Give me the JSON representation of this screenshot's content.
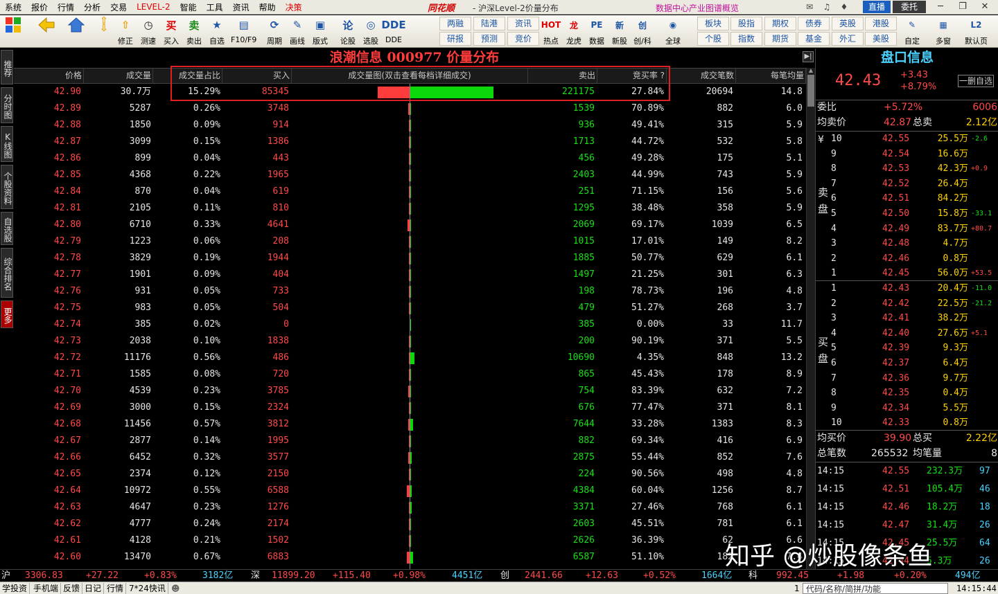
{
  "menubar": {
    "items": [
      "系统",
      "报价",
      "行情",
      "分析",
      "交易",
      "LEVEL-2",
      "智能",
      "工具",
      "资讯",
      "帮助",
      "决策"
    ],
    "brand": "同花顺",
    "window_title": "- 沪深Level-2价量分布",
    "ad_text": "数据中心产业图谱概览",
    "zhibo": "直播",
    "weituo": "委托"
  },
  "toolbar": {
    "big": [
      {
        "name": "修正",
        "icon": "⇧"
      },
      {
        "name": "测速",
        "icon": "◷"
      },
      {
        "name": "买入",
        "icon": "买"
      },
      {
        "name": "卖出",
        "icon": "卖"
      },
      {
        "name": "自选",
        "icon": "★"
      },
      {
        "name": "F10/F9",
        "icon": "▤"
      },
      {
        "name": "周期",
        "icon": "⟳"
      },
      {
        "name": "画线",
        "icon": "✎"
      },
      {
        "name": "版式",
        "icon": "▣"
      },
      {
        "name": "论股",
        "icon": "论"
      },
      {
        "name": "选股",
        "icon": "◎"
      },
      {
        "name": "DDE",
        "icon": "DDE"
      }
    ],
    "small_top": [
      "两融",
      "陆港",
      "资讯"
    ],
    "small_bottom": [
      "研报",
      "预测",
      "竞价"
    ],
    "big2": [
      {
        "name": "热点",
        "icon": "HOT"
      },
      {
        "name": "龙虎",
        "icon": "龙"
      },
      {
        "name": "数据",
        "icon": "PE"
      },
      {
        "name": "新股",
        "icon": "新"
      },
      {
        "name": "创/科",
        "icon": "创"
      },
      {
        "name": "全球",
        "icon": "◉"
      }
    ],
    "small2_top": [
      "板块",
      "股指",
      "期权",
      "债券",
      "英股",
      "港股"
    ],
    "small2_bottom": [
      "个股",
      "指数",
      "期货",
      "基金",
      "外汇",
      "美股"
    ],
    "big3": [
      {
        "name": "自定",
        "icon": "✎"
      },
      {
        "name": "多窗",
        "icon": "▦"
      },
      {
        "name": "默认页",
        "icon": "L2"
      }
    ]
  },
  "sidetabs": [
    "推荐",
    "分时图",
    "K线图",
    "个股资料",
    "自选股",
    "综合排名",
    "更多"
  ],
  "page_title": "浪潮信息 000977 价量分布",
  "columns": {
    "price": "价格",
    "volume": "成交量",
    "ratio": "成交量占比",
    "buy": "买入",
    "chart": "成交量图(双击查看每档详细成交)",
    "sell": "卖出",
    "buy_rate": "竞买率 ?",
    "trades": "成交笔数",
    "avg": "每笔均量"
  },
  "rows": [
    {
      "price": "42.90",
      "volume": "30.7万",
      "ratio": "15.29%",
      "buy": "85345",
      "sell": "221175",
      "buy_rate": "27.84%",
      "trades": "20694",
      "avg": "14.8",
      "buy_n": 85345,
      "sell_n": 221175
    },
    {
      "price": "42.89",
      "volume": "5287",
      "ratio": "0.26%",
      "buy": "3748",
      "sell": "1539",
      "buy_rate": "70.89%",
      "trades": "882",
      "avg": "6.0",
      "buy_n": 3748,
      "sell_n": 1539
    },
    {
      "price": "42.88",
      "volume": "1850",
      "ratio": "0.09%",
      "buy": "914",
      "sell": "936",
      "buy_rate": "49.41%",
      "trades": "315",
      "avg": "5.9",
      "buy_n": 914,
      "sell_n": 936
    },
    {
      "price": "42.87",
      "volume": "3099",
      "ratio": "0.15%",
      "buy": "1386",
      "sell": "1713",
      "buy_rate": "44.72%",
      "trades": "532",
      "avg": "5.8",
      "buy_n": 1386,
      "sell_n": 1713
    },
    {
      "price": "42.86",
      "volume": "899",
      "ratio": "0.04%",
      "buy": "443",
      "sell": "456",
      "buy_rate": "49.28%",
      "trades": "175",
      "avg": "5.1",
      "buy_n": 443,
      "sell_n": 456
    },
    {
      "price": "42.85",
      "volume": "4368",
      "ratio": "0.22%",
      "buy": "1965",
      "sell": "2403",
      "buy_rate": "44.99%",
      "trades": "743",
      "avg": "5.9",
      "buy_n": 1965,
      "sell_n": 2403
    },
    {
      "price": "42.84",
      "volume": "870",
      "ratio": "0.04%",
      "buy": "619",
      "sell": "251",
      "buy_rate": "71.15%",
      "trades": "156",
      "avg": "5.6",
      "buy_n": 619,
      "sell_n": 251
    },
    {
      "price": "42.81",
      "volume": "2105",
      "ratio": "0.11%",
      "buy": "810",
      "sell": "1295",
      "buy_rate": "38.48%",
      "trades": "358",
      "avg": "5.9",
      "buy_n": 810,
      "sell_n": 1295
    },
    {
      "price": "42.80",
      "volume": "6710",
      "ratio": "0.33%",
      "buy": "4641",
      "sell": "2069",
      "buy_rate": "69.17%",
      "trades": "1039",
      "avg": "6.5",
      "buy_n": 4641,
      "sell_n": 2069
    },
    {
      "price": "42.79",
      "volume": "1223",
      "ratio": "0.06%",
      "buy": "208",
      "sell": "1015",
      "buy_rate": "17.01%",
      "trades": "149",
      "avg": "8.2",
      "buy_n": 208,
      "sell_n": 1015
    },
    {
      "price": "42.78",
      "volume": "3829",
      "ratio": "0.19%",
      "buy": "1944",
      "sell": "1885",
      "buy_rate": "50.77%",
      "trades": "629",
      "avg": "6.1",
      "buy_n": 1944,
      "sell_n": 1885
    },
    {
      "price": "42.77",
      "volume": "1901",
      "ratio": "0.09%",
      "buy": "404",
      "sell": "1497",
      "buy_rate": "21.25%",
      "trades": "301",
      "avg": "6.3",
      "buy_n": 404,
      "sell_n": 1497
    },
    {
      "price": "42.76",
      "volume": "931",
      "ratio": "0.05%",
      "buy": "733",
      "sell": "198",
      "buy_rate": "78.73%",
      "trades": "196",
      "avg": "4.8",
      "buy_n": 733,
      "sell_n": 198
    },
    {
      "price": "42.75",
      "volume": "983",
      "ratio": "0.05%",
      "buy": "504",
      "sell": "479",
      "buy_rate": "51.27%",
      "trades": "268",
      "avg": "3.7",
      "buy_n": 504,
      "sell_n": 479
    },
    {
      "price": "42.74",
      "volume": "385",
      "ratio": "0.02%",
      "buy": "0",
      "sell": "385",
      "buy_rate": "0.00%",
      "trades": "33",
      "avg": "11.7",
      "buy_n": 0,
      "sell_n": 385
    },
    {
      "price": "42.73",
      "volume": "2038",
      "ratio": "0.10%",
      "buy": "1838",
      "sell": "200",
      "buy_rate": "90.19%",
      "trades": "371",
      "avg": "5.5",
      "buy_n": 1838,
      "sell_n": 200
    },
    {
      "price": "42.72",
      "volume": "11176",
      "ratio": "0.56%",
      "buy": "486",
      "sell": "10690",
      "buy_rate": "4.35%",
      "trades": "848",
      "avg": "13.2",
      "buy_n": 486,
      "sell_n": 10690
    },
    {
      "price": "42.71",
      "volume": "1585",
      "ratio": "0.08%",
      "buy": "720",
      "sell": "865",
      "buy_rate": "45.43%",
      "trades": "178",
      "avg": "8.9",
      "buy_n": 720,
      "sell_n": 865
    },
    {
      "price": "42.70",
      "volume": "4539",
      "ratio": "0.23%",
      "buy": "3785",
      "sell": "754",
      "buy_rate": "83.39%",
      "trades": "632",
      "avg": "7.2",
      "buy_n": 3785,
      "sell_n": 754
    },
    {
      "price": "42.69",
      "volume": "3000",
      "ratio": "0.15%",
      "buy": "2324",
      "sell": "676",
      "buy_rate": "77.47%",
      "trades": "371",
      "avg": "8.1",
      "buy_n": 2324,
      "sell_n": 676
    },
    {
      "price": "42.68",
      "volume": "11456",
      "ratio": "0.57%",
      "buy": "3812",
      "sell": "7644",
      "buy_rate": "33.28%",
      "trades": "1383",
      "avg": "8.3",
      "buy_n": 3812,
      "sell_n": 7644
    },
    {
      "price": "42.67",
      "volume": "2877",
      "ratio": "0.14%",
      "buy": "1995",
      "sell": "882",
      "buy_rate": "69.34%",
      "trades": "416",
      "avg": "6.9",
      "buy_n": 1995,
      "sell_n": 882
    },
    {
      "price": "42.66",
      "volume": "6452",
      "ratio": "0.32%",
      "buy": "3577",
      "sell": "2875",
      "buy_rate": "55.44%",
      "trades": "852",
      "avg": "7.6",
      "buy_n": 3577,
      "sell_n": 2875
    },
    {
      "price": "42.65",
      "volume": "2374",
      "ratio": "0.12%",
      "buy": "2150",
      "sell": "224",
      "buy_rate": "90.56%",
      "trades": "498",
      "avg": "4.8",
      "buy_n": 2150,
      "sell_n": 224
    },
    {
      "price": "42.64",
      "volume": "10972",
      "ratio": "0.55%",
      "buy": "6588",
      "sell": "4384",
      "buy_rate": "60.04%",
      "trades": "1256",
      "avg": "8.7",
      "buy_n": 6588,
      "sell_n": 4384
    },
    {
      "price": "42.63",
      "volume": "4647",
      "ratio": "0.23%",
      "buy": "1276",
      "sell": "3371",
      "buy_rate": "27.46%",
      "trades": "768",
      "avg": "6.1",
      "buy_n": 1276,
      "sell_n": 3371
    },
    {
      "price": "42.62",
      "volume": "4777",
      "ratio": "0.24%",
      "buy": "2174",
      "sell": "2603",
      "buy_rate": "45.51%",
      "trades": "781",
      "avg": "6.1",
      "buy_n": 2174,
      "sell_n": 2603
    },
    {
      "price": "42.61",
      "volume": "4128",
      "ratio": "0.21%",
      "buy": "1502",
      "sell": "2626",
      "buy_rate": "36.39%",
      "trades": "62",
      "avg": "6.6",
      "buy_n": 1502,
      "sell_n": 2626
    },
    {
      "price": "42.60",
      "volume": "13470",
      "ratio": "0.67%",
      "buy": "6883",
      "sell": "6587",
      "buy_rate": "51.10%",
      "trades": "182",
      "avg": "7.4",
      "buy_n": 6883,
      "sell_n": 6587
    }
  ],
  "right_panel": {
    "title": "盘口信息",
    "price": "42.43",
    "change": "+3.43",
    "change_pct": "+8.79%",
    "button": "一删自选",
    "weibi_label": "委比",
    "weibi_value": "+5.72%",
    "weibi_num": "6006",
    "ask_avg_label": "均卖价",
    "ask_avg": "42.87",
    "ask_total_label": "总卖",
    "ask_total": "2.12亿",
    "sell_side_label": "卖盘",
    "buy_side_label": "买盘",
    "sell_currency": "¥",
    "asks": [
      {
        "level": "10",
        "price": "42.55",
        "vol": "25.5万",
        "delta": "-2.6",
        "up": false
      },
      {
        "level": "9",
        "price": "42.54",
        "vol": "16.6万",
        "delta": "",
        "up": true
      },
      {
        "level": "8",
        "price": "42.53",
        "vol": "42.3万",
        "delta": "+0.9",
        "up": true
      },
      {
        "level": "7",
        "price": "42.52",
        "vol": "26.4万",
        "delta": "",
        "up": true
      },
      {
        "level": "6",
        "price": "42.51",
        "vol": "84.2万",
        "delta": "",
        "up": true
      },
      {
        "level": "5",
        "price": "42.50",
        "vol": "15.8万",
        "delta": "-33.1",
        "up": false
      },
      {
        "level": "4",
        "price": "42.49",
        "vol": "83.7万",
        "delta": "+80.7",
        "up": true
      },
      {
        "level": "3",
        "price": "42.48",
        "vol": "4.7万",
        "delta": "",
        "up": true
      },
      {
        "level": "2",
        "price": "42.46",
        "vol": "0.8万",
        "delta": "",
        "up": true
      },
      {
        "level": "1",
        "price": "42.45",
        "vol": "56.0万",
        "delta": "+53.5",
        "up": true
      }
    ],
    "bids": [
      {
        "level": "1",
        "price": "42.43",
        "vol": "20.4万",
        "delta": "-11.0",
        "up": false
      },
      {
        "level": "2",
        "price": "42.42",
        "vol": "22.5万",
        "delta": "-21.2",
        "up": false
      },
      {
        "level": "3",
        "price": "42.41",
        "vol": "38.2万",
        "delta": "",
        "up": true
      },
      {
        "level": "4",
        "price": "42.40",
        "vol": "27.6万",
        "delta": "+5.1",
        "up": true
      },
      {
        "level": "5",
        "price": "42.39",
        "vol": "9.3万",
        "delta": "",
        "up": true
      },
      {
        "level": "6",
        "price": "42.37",
        "vol": "6.4万",
        "delta": "",
        "up": true
      },
      {
        "level": "7",
        "price": "42.36",
        "vol": "9.7万",
        "delta": "",
        "up": true
      },
      {
        "level": "8",
        "price": "42.35",
        "vol": "0.4万",
        "delta": "",
        "up": true
      },
      {
        "level": "9",
        "price": "42.34",
        "vol": "5.5万",
        "delta": "",
        "up": true
      },
      {
        "level": "10",
        "price": "42.33",
        "vol": "0.8万",
        "delta": "",
        "up": true
      }
    ],
    "bid_avg_label": "均买价",
    "bid_avg": "39.90",
    "bid_total_label": "总买",
    "bid_total": "2.22亿",
    "total_trades_label": "总笔数",
    "total_trades": "265532",
    "avg_lot_label": "均笔量",
    "avg_lot": "8",
    "ticks": [
      {
        "time": "14:15",
        "price": "42.55",
        "vol": "232.3万",
        "n": "97"
      },
      {
        "time": "14:15",
        "price": "42.51",
        "vol": "105.4万",
        "n": "46"
      },
      {
        "time": "14:15",
        "price": "42.46",
        "vol": "18.2万",
        "n": "18"
      },
      {
        "time": "14:15",
        "price": "42.47",
        "vol": "31.4万",
        "n": "26"
      },
      {
        "time": "14:15",
        "price": "42.45",
        "vol": "25.5万",
        "n": "64"
      },
      {
        "time": "14:15",
        "price": "42.44",
        "vol": "5.3万",
        "n": "26"
      }
    ]
  },
  "status": {
    "sh_label": "沪",
    "sh_val": "3306.83",
    "sh_chg": "+27.22",
    "sh_pct": "+0.83%",
    "sh_amt": "3182亿",
    "sz_label": "深",
    "sz_val": "11899.20",
    "sz_chg": "+115.40",
    "sz_pct": "+0.98%",
    "sz_amt": "4451亿",
    "cy_label": "创",
    "cy_val": "2441.66",
    "cy_chg": "+12.63",
    "cy_pct": "+0.52%",
    "cy_amt": "1664亿",
    "kc_label": "科",
    "kc_val": "992.45",
    "kc_chg": "+1.98",
    "kc_pct": "+0.20%",
    "kc_amt": "494亿"
  },
  "bottom": {
    "tabs": [
      "学投资",
      "手机端",
      "反馈",
      "日记",
      "行情",
      "7*24快讯"
    ],
    "search_placeholder": "代码/名称/简拼/功能",
    "page_num": "1",
    "clock": "14:15:44"
  },
  "watermark": "知乎 @炒股像条鱼",
  "colors": {
    "up": "#ff4a4a",
    "down": "#16e016",
    "accent": "#4ad3ff",
    "volume": "#ffd200"
  }
}
